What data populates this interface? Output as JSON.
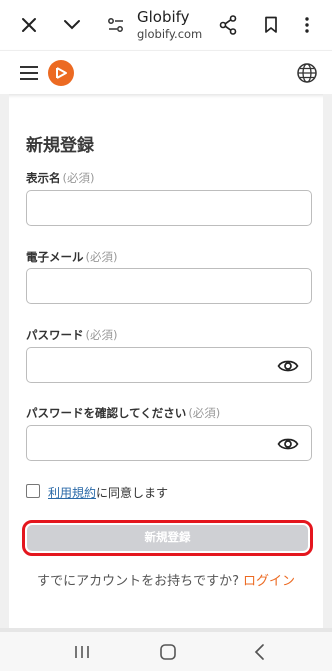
{
  "browser": {
    "site_title": "Globify",
    "site_url": "globify.com"
  },
  "form": {
    "title": "新規登録",
    "fields": [
      {
        "label": "表示名",
        "required": "(必須)"
      },
      {
        "label": "電子メール",
        "required": "(必須)"
      },
      {
        "label": "パスワード",
        "required": "(必須)"
      },
      {
        "label": "パスワードを確認してください",
        "required": "(必須)"
      }
    ],
    "agree": {
      "link": "利用規約",
      "text": "に同意します"
    },
    "submit_label": "新規登録",
    "login_prompt": "すでにアカウントをお持ちですか?",
    "login_link": "ログイン"
  },
  "colors": {
    "accent": "#ec6a22",
    "highlight": "#e4161e",
    "disabled_button": "#cfd0d4"
  }
}
